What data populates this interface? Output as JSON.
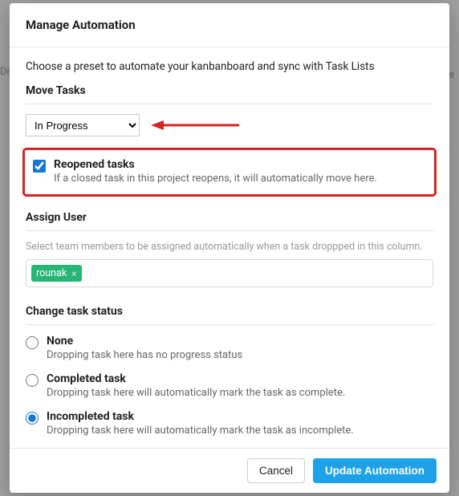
{
  "bg": {
    "left": "Di",
    "right": "ce"
  },
  "header": {
    "title": "Manage Automation"
  },
  "intro": "Choose a preset to automate your kanbanboard and sync with Task Lists",
  "move": {
    "title": "Move Tasks",
    "selected": "In Progress",
    "reopened": {
      "label": "Reopened tasks",
      "desc": "If a closed task in this project reopens, it will automatically move here."
    }
  },
  "assign": {
    "title": "Assign User",
    "hint": "Select team members to be assigned automatically when a task droppped in this column.",
    "tags": [
      {
        "name": "rounak"
      }
    ]
  },
  "status": {
    "title": "Change task status",
    "options": [
      {
        "label": "None",
        "desc": "Dropping task here has no progress status"
      },
      {
        "label": "Completed task",
        "desc": "Dropping task here will automatically mark the task as complete."
      },
      {
        "label": "Incompleted task",
        "desc": "Dropping task here will automatically mark the task as incomplete."
      }
    ],
    "selected_index": 2
  },
  "footer": {
    "cancel": "Cancel",
    "update": "Update Automation"
  }
}
